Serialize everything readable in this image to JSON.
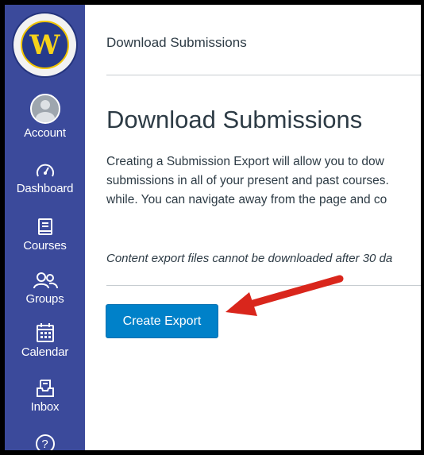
{
  "nav": {
    "logo_icon": "school-seal-icon",
    "items": [
      {
        "label": "Account",
        "icon": "user-avatar-icon"
      },
      {
        "label": "Dashboard",
        "icon": "dashboard-icon"
      },
      {
        "label": "Courses",
        "icon": "book-icon"
      },
      {
        "label": "Groups",
        "icon": "users-icon"
      },
      {
        "label": "Calendar",
        "icon": "calendar-icon"
      },
      {
        "label": "Inbox",
        "icon": "inbox-icon"
      },
      {
        "label": "",
        "icon": "help-icon"
      }
    ],
    "background": "#3b4a9b"
  },
  "header": {
    "breadcrumb": "Download Submissions"
  },
  "main": {
    "title": "Download Submissions",
    "description": [
      "Creating a Submission Export will allow you to dow",
      "submissions in all of your present and past courses.",
      "while. You can navigate away from the page and co"
    ],
    "note": "Content export files cannot be downloaded after 30 da",
    "button_label": "Create Export",
    "button_color": "#0081c9",
    "annotation_arrow_color": "#d9261c"
  }
}
